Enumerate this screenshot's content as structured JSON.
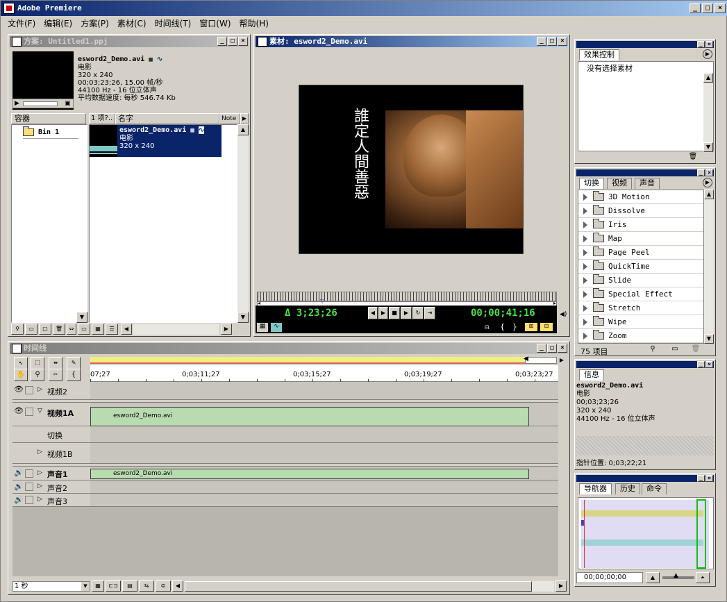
{
  "app": {
    "title": "Adobe Premiere"
  },
  "menu": [
    "文件(F)",
    "编辑(E)",
    "方案(P)",
    "素材(C)",
    "时间线(T)",
    "窗口(W)",
    "帮助(H)"
  ],
  "window_buttons": [
    "_",
    "□",
    "×"
  ],
  "project": {
    "title": "方案: Untitled1.ppj",
    "clip_name": "esword2_Demo.avi",
    "info_lines": [
      "电影",
      "320 x 240",
      "00;03;23;26, 15.00 帧/秒",
      "44100 Hz - 16 位立体声",
      "平均数据速度: 每秒 546.74 Kb"
    ],
    "bin_header": "容器",
    "bin_item": "Bin 1",
    "col_items": "1 项?..",
    "col_name": "名字",
    "col_note": "Note",
    "item_name": "esword2_Demo.avi",
    "item_type": "电影",
    "item_size": "320 x 240"
  },
  "monitor": {
    "title": "素材: esword2_Demo.avi",
    "calligraphy": "誰定人間善惡",
    "duration_tc": "Δ 3;23;26",
    "current_tc": "00;00;41;16"
  },
  "timeline": {
    "title": "时间线",
    "ruler": [
      "07;27",
      "0;03;11;27",
      "0;03;15;27",
      "0;03;19;27",
      "0;03;23;27"
    ],
    "tracks": [
      {
        "label": "视频2"
      },
      {
        "label": "视频1A",
        "clip": "esword2_Demo.avi"
      },
      {
        "label": "切换"
      },
      {
        "label": "视频1B"
      },
      {
        "label": "声音1",
        "clip": "esword2_Demo.avi"
      },
      {
        "label": "声音2"
      },
      {
        "label": "声音3"
      }
    ],
    "zoom": "1 秒"
  },
  "effects": {
    "tab": "效果控制",
    "message": "没有选择素材"
  },
  "transitions": {
    "tabs": [
      "切换",
      "视频",
      "声音"
    ],
    "items": [
      "3D Motion",
      "Dissolve",
      "Iris",
      "Map",
      "Page Peel",
      "QuickTime",
      "Slide",
      "Special Effect",
      "Stretch",
      "Wipe",
      "Zoom"
    ],
    "count": "75 项目"
  },
  "info": {
    "tab": "信息",
    "name": "esword2_Demo.avi",
    "lines": [
      "电影",
      "00;03;23;26",
      "320 x 240",
      "44100 Hz - 16 位立体声"
    ],
    "cursor": "指针位置: 0;03;22;21"
  },
  "navigator": {
    "tabs": [
      "导航器",
      "历史",
      "命令"
    ],
    "timecode": "00;00;00;00"
  },
  "colors": {
    "title_active": "#0a246a",
    "selection": "#0a246a",
    "clip_green": "#b8dcb0",
    "timecode_green": "#48e048"
  }
}
